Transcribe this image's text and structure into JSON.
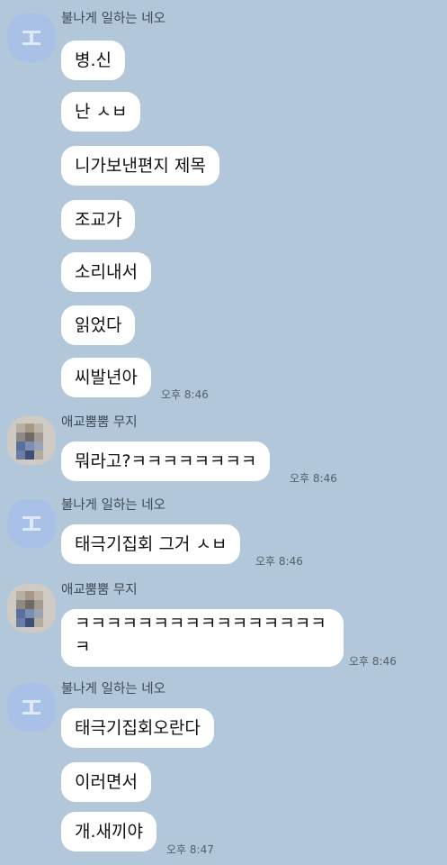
{
  "groups": [
    {
      "sender": "불나게 일하는 네오",
      "avatar": "default-profile-icon",
      "messages": [
        {
          "text": "병.신"
        },
        {
          "text": "난 ㅅㅂ"
        },
        {
          "text": "니가보낸편지 제목"
        },
        {
          "text": "조교가"
        },
        {
          "text": "소리내서"
        },
        {
          "text": "읽었다"
        },
        {
          "text": "씨발년아",
          "time": "오후 8:46"
        }
      ]
    },
    {
      "sender": "애교뿜뿜 무지",
      "avatar": "blurred-profile-photo",
      "messages": [
        {
          "text": "뭐라고?ㅋㅋㅋㅋㅋㅋㅋㅋ",
          "time": "오후 8:46"
        }
      ]
    },
    {
      "sender": "불나게 일하는 네오",
      "avatar": "default-profile-icon",
      "messages": [
        {
          "text": "태극기집회 그거 ㅅㅂ",
          "time": "오후 8:46"
        }
      ]
    },
    {
      "sender": "애교뿜뿜 무지",
      "avatar": "blurred-profile-photo",
      "messages": [
        {
          "text": "ㅋㅋㅋㅋㅋㅋㅋㅋㅋㅋㅋㅋㅋㅋㅋㅋㅋ",
          "time": "오후 8:46"
        }
      ]
    },
    {
      "sender": "불나게 일하는 네오",
      "avatar": "default-profile-icon",
      "messages": [
        {
          "text": "태극기집회오란다"
        },
        {
          "text": "이러면서"
        },
        {
          "text": "개.새끼야",
          "time": "오후 8:47"
        }
      ]
    }
  ],
  "colors": {
    "background": "#b2c7d9",
    "bubble": "#ffffff",
    "default_avatar": "#a9c1e6"
  }
}
